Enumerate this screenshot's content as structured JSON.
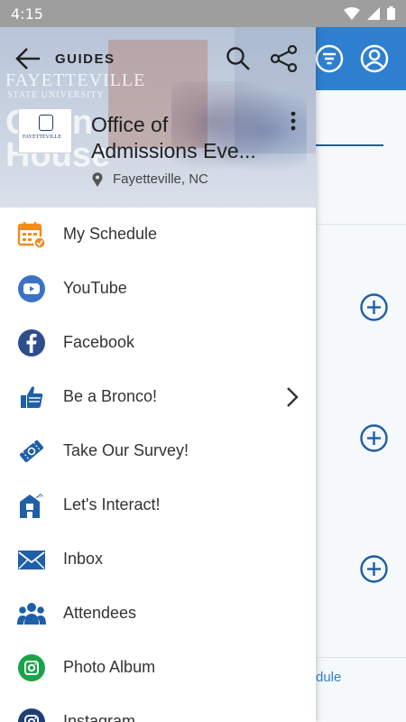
{
  "status_bar": {
    "time": "4:15"
  },
  "drawer": {
    "header": {
      "back_label": "GUIDES",
      "hero_text_line1": "Open",
      "hero_text_line2": "House",
      "hero_mark": "FAYETTEVILLE",
      "hero_mark_sub": "STATE UNIVERSITY",
      "logo_text": "FAYETTEVILLE",
      "title_line1": "Office of",
      "title_line2": "Admissions Eve...",
      "location": "Fayetteville, NC"
    },
    "items": [
      {
        "label": "My Schedule",
        "icon": "calendar-check-icon",
        "color": "#f28b1e"
      },
      {
        "label": "YouTube",
        "icon": "youtube-icon",
        "color": "#3a73c6"
      },
      {
        "label": "Facebook",
        "icon": "facebook-icon",
        "color": "#2e4d8c"
      },
      {
        "label": "Be a Bronco!",
        "icon": "thumbs-up-icon",
        "color": "#1f5fa8",
        "has_submenu": true
      },
      {
        "label": "Take Our Survey!",
        "icon": "ticket-icon",
        "color": "#1f5fa8"
      },
      {
        "label": "Let's Interact!",
        "icon": "interact-icon",
        "color": "#1f5fa8"
      },
      {
        "label": "Inbox",
        "icon": "envelope-icon",
        "color": "#1f5fa8"
      },
      {
        "label": "Attendees",
        "icon": "people-icon",
        "color": "#1f5fa8"
      },
      {
        "label": "Photo Album",
        "icon": "photo-album-icon",
        "color": "#1aa34a"
      },
      {
        "label": "Instagram",
        "icon": "instagram-icon",
        "color": "#1f3f74"
      }
    ]
  },
  "background": {
    "partial_text": "dule",
    "accent": "#2f7fd0"
  }
}
